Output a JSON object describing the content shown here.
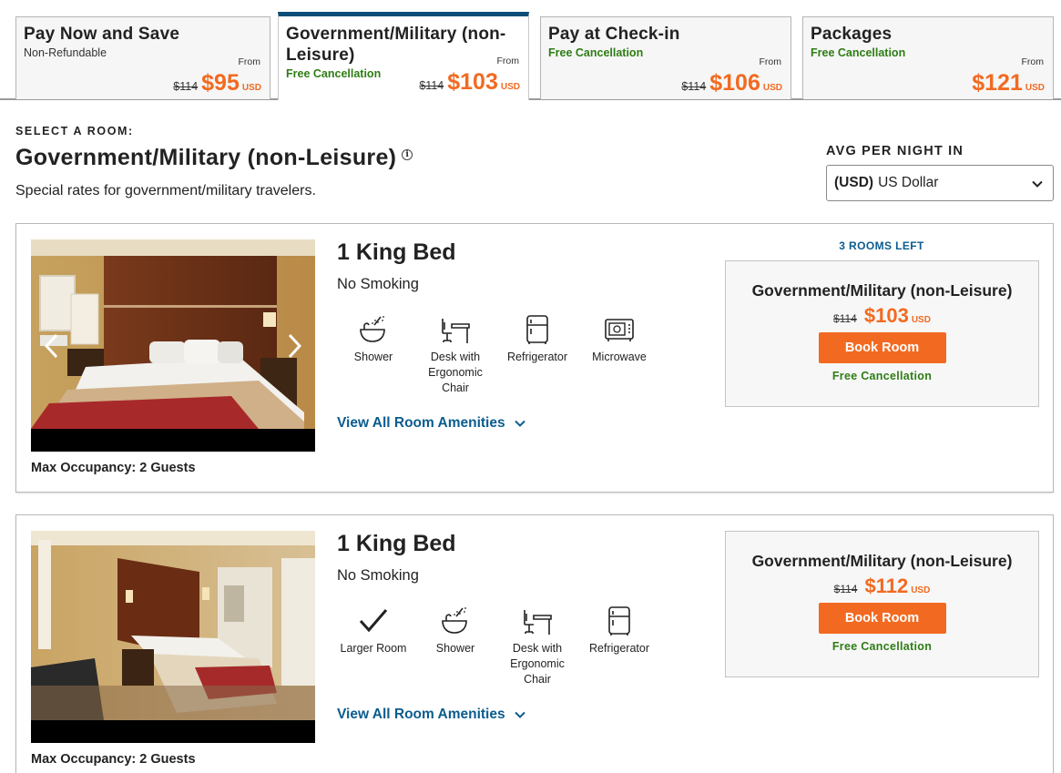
{
  "rate_tabs": [
    {
      "title": "Pay Now and Save",
      "subtitle": "Non-Refundable",
      "from_label": "From",
      "original_price": "$114",
      "price": "$95",
      "currency": "USD"
    },
    {
      "title": "Government/Military (non-Leisure)",
      "subtitle": "Free Cancellation",
      "from_label": "From",
      "original_price": "$114",
      "price": "$103",
      "currency": "USD"
    },
    {
      "title": "Pay at Check-in",
      "subtitle": "Free Cancellation",
      "from_label": "From",
      "original_price": "$114",
      "price": "$106",
      "currency": "USD"
    },
    {
      "title": "Packages",
      "subtitle": "Free Cancellation",
      "from_label": "From",
      "original_price": "",
      "price": "$121",
      "currency": "USD"
    }
  ],
  "active_tab": "Government/Military (non-Leisure)",
  "header": {
    "select_label": "SELECT A ROOM:",
    "rate_title": "Government/Military (non-Leisure)",
    "rate_description": "Special rates for government/military travelers.",
    "info_icon": "info-icon"
  },
  "currency": {
    "label": "AVG PER NIGHT IN",
    "selected_code": "(USD)",
    "selected_name": "US Dollar"
  },
  "rooms": [
    {
      "name": "1 King Bed",
      "smoking": "No Smoking",
      "amenities": [
        {
          "label": "Shower",
          "icon": "shower-icon"
        },
        {
          "label": "Desk with Ergonomic Chair",
          "icon": "desk-chair-icon"
        },
        {
          "label": "Refrigerator",
          "icon": "refrigerator-icon"
        },
        {
          "label": "Microwave",
          "icon": "microwave-icon"
        }
      ],
      "view_all": "View All Room Amenities",
      "occupancy": "Max Occupancy: 2 Guests",
      "rooms_left": "3 ROOMS LEFT",
      "rate_name": "Government/Military (non-Leisure)",
      "original_price": "$114",
      "price": "$103",
      "currency": "USD",
      "book_label": "Book Room",
      "cancellation": "Free Cancellation"
    },
    {
      "name": "1 King Bed",
      "smoking": "No Smoking",
      "amenities": [
        {
          "label": "Larger Room",
          "icon": "checkmark-icon"
        },
        {
          "label": "Shower",
          "icon": "shower-icon"
        },
        {
          "label": "Desk with Ergonomic Chair",
          "icon": "desk-chair-icon"
        },
        {
          "label": "Refrigerator",
          "icon": "refrigerator-icon"
        }
      ],
      "view_all": "View All Room Amenities",
      "occupancy": "Max Occupancy: 2 Guests",
      "rooms_left": "",
      "rate_name": "Government/Military (non-Leisure)",
      "original_price": "$114",
      "price": "$112",
      "currency": "USD",
      "book_label": "Book Room",
      "cancellation": "Free Cancellation"
    }
  ],
  "colors": {
    "accent_orange": "#f26a21",
    "link_blue": "#0b5c8f",
    "active_tab_border": "#0a4d78",
    "free_cancel_green": "#2e7d14"
  }
}
